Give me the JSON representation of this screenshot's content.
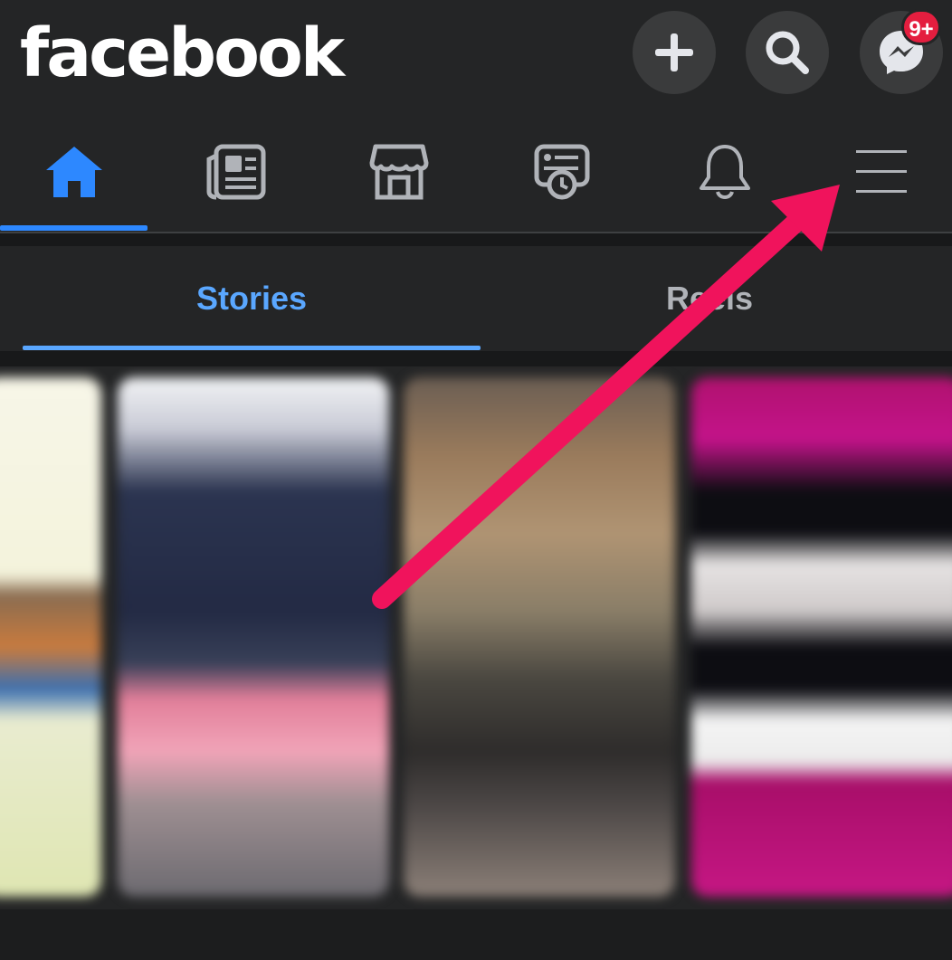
{
  "app": {
    "logo_text": "facebook"
  },
  "header": {
    "buttons": [
      {
        "name": "create",
        "icon": "plus-icon"
      },
      {
        "name": "search",
        "icon": "search-icon"
      },
      {
        "name": "messenger",
        "icon": "messenger-icon",
        "badge": "9+"
      }
    ]
  },
  "nav": {
    "items": [
      {
        "name": "home",
        "icon": "home-icon",
        "active": true
      },
      {
        "name": "news",
        "icon": "news-feed-icon"
      },
      {
        "name": "marketplace",
        "icon": "marketplace-icon"
      },
      {
        "name": "memories",
        "icon": "memories-icon"
      },
      {
        "name": "notifications",
        "icon": "bell-icon"
      },
      {
        "name": "menu",
        "icon": "hamburger-menu-icon"
      }
    ]
  },
  "tabs": {
    "stories_label": "Stories",
    "reels_label": "Reels"
  },
  "colors": {
    "accent": "#2d88ff",
    "tab_active": "#5aa7ff",
    "annotation_arrow": "#f0135c",
    "badge": "#e41e3f"
  }
}
